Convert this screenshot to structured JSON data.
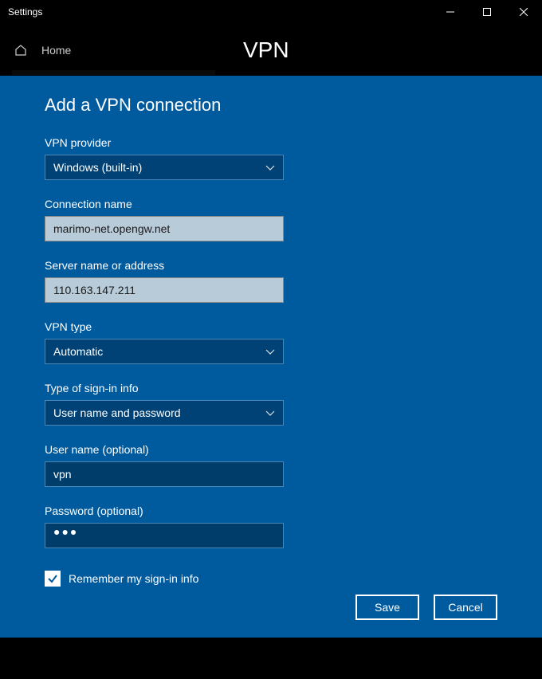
{
  "window": {
    "title": "Settings"
  },
  "header": {
    "home": "Home",
    "page": "VPN"
  },
  "panel": {
    "title": "Add a VPN connection"
  },
  "fields": {
    "provider": {
      "label": "VPN provider",
      "value": "Windows (built-in)"
    },
    "connection_name": {
      "label": "Connection name",
      "value": "marimo-net.opengw.net"
    },
    "server": {
      "label": "Server name or address",
      "value": "110.163.147.211"
    },
    "vpn_type": {
      "label": "VPN type",
      "value": "Automatic"
    },
    "signin_type": {
      "label": "Type of sign-in info",
      "value": "User name and password"
    },
    "username": {
      "label": "User name (optional)",
      "value": "vpn"
    },
    "password": {
      "label": "Password (optional)",
      "value": "●●●"
    },
    "remember": {
      "label": "Remember my sign-in info",
      "checked": true
    }
  },
  "buttons": {
    "save": "Save",
    "cancel": "Cancel"
  }
}
